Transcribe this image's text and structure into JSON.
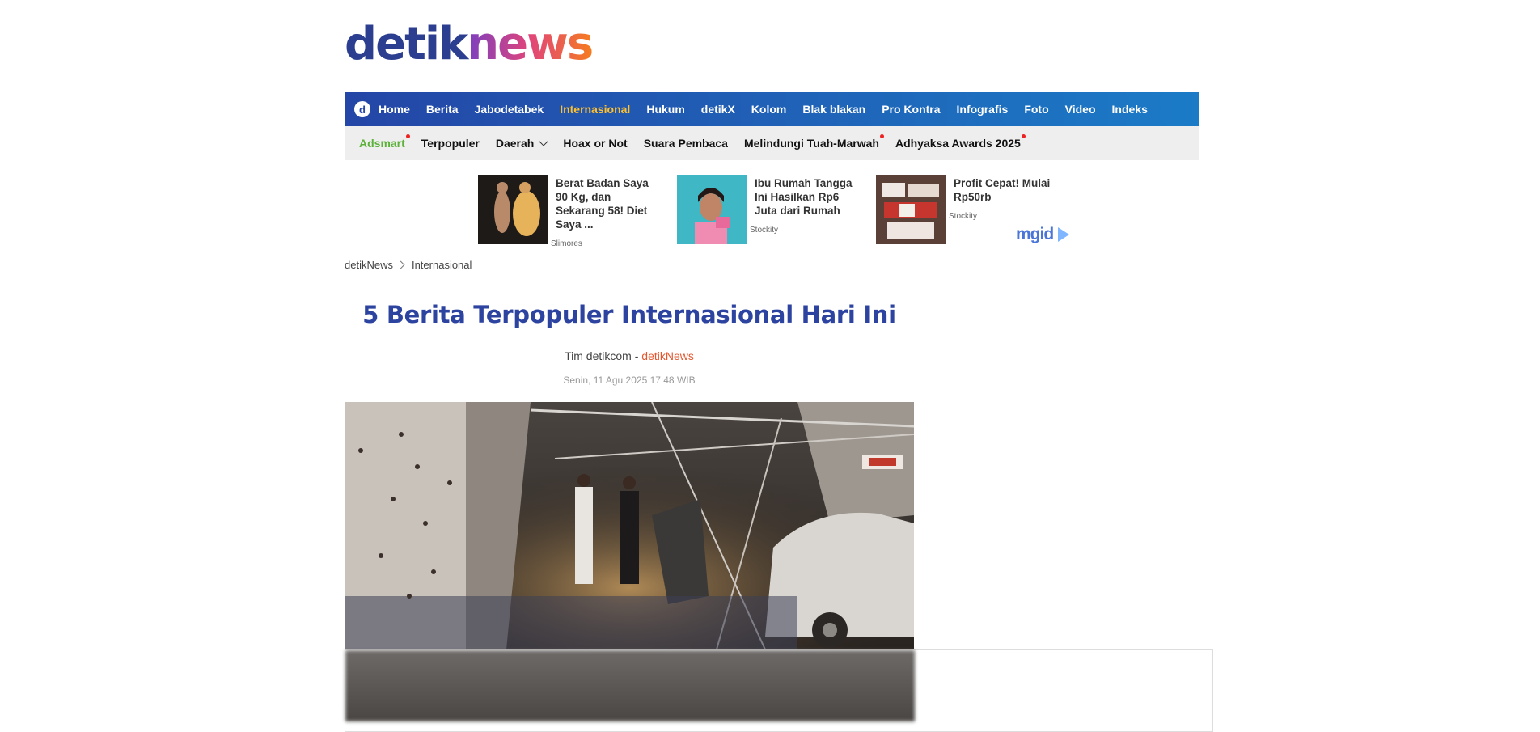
{
  "logo": {
    "part1": "detik",
    "part2": "news"
  },
  "nav_primary": {
    "icon": "detik-d-logo",
    "items": [
      "Home",
      "Berita",
      "Jabodetabek",
      "Internasional",
      "Hukum",
      "detikX",
      "Kolom",
      "Blak blakan",
      "Pro Kontra",
      "Infografis",
      "Foto",
      "Video",
      "Indeks"
    ],
    "active": "Internasional"
  },
  "nav_secondary": {
    "items": [
      "Adsmart",
      "Terpopuler",
      "Daerah",
      "Hoax or Not",
      "Suara Pembaca",
      "Melindungi Tuah-Marwah",
      "Adhyaksa Awards 2025"
    ]
  },
  "ads": [
    {
      "title": "Berat Badan Saya 90 Kg, dan Sekarang 58! Diet Saya ...",
      "source": "Slimores"
    },
    {
      "title": "Ibu Rumah Tangga Ini Hasilkan Rp6 Juta dari Rumah",
      "source": "Stockity"
    },
    {
      "title": "Profit Cepat! Mulai Rp50rb",
      "source": "Stockity"
    }
  ],
  "ad_network": "mgid",
  "breadcrumb": [
    "detikNews",
    "Internasional"
  ],
  "article": {
    "title": "5 Berita Terpopuler Internasional Hari Ini",
    "author": "Tim detikcom",
    "separator": " - ",
    "source": "detikNews",
    "date": "Senin, 11 Agu 2025 17:48 WIB"
  },
  "colors": {
    "nav_start": "#2446a6",
    "nav_end": "#1b7bc6",
    "active": "#ffc12e",
    "headline": "#2c43a0",
    "source": "#e4572e"
  }
}
